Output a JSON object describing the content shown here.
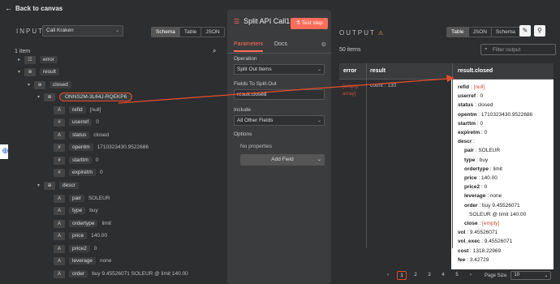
{
  "back_label": "Back to canvas",
  "input": {
    "title": "INPUT",
    "node": "Call Kraken",
    "tabs": [
      "Schema",
      "Table",
      "JSON"
    ],
    "active_tab": "Schema",
    "items": "1 item",
    "tree": [
      {
        "icon": "☷",
        "key": "error",
        "val": "",
        "caret": "▸"
      },
      {
        "icon": "⊕",
        "key": "result",
        "val": "",
        "caret": "▾"
      },
      {
        "icon": "⊕",
        "key": "closed",
        "val": "",
        "caret": "▾"
      },
      {
        "icon": "⊕",
        "key": "ONNS2M-3L64J-RQEKP6",
        "val": "",
        "caret": "▾"
      },
      {
        "icon": "A",
        "key": "refid",
        "val": "[null]"
      },
      {
        "icon": "#",
        "key": "userref",
        "val": "0"
      },
      {
        "icon": "A",
        "key": "status",
        "val": "closed"
      },
      {
        "icon": "#",
        "key": "opentm",
        "val": "1710323430.9522686"
      },
      {
        "icon": "#",
        "key": "starttm",
        "val": "0"
      },
      {
        "icon": "#",
        "key": "expiretm",
        "val": "0"
      },
      {
        "icon": "⊕",
        "key": "descr",
        "val": "",
        "caret": "▾"
      },
      {
        "icon": "A",
        "key": "pair",
        "val": "SOLEUR"
      },
      {
        "icon": "A",
        "key": "type",
        "val": "buy"
      },
      {
        "icon": "A",
        "key": "ordertype",
        "val": "limit"
      },
      {
        "icon": "A",
        "key": "price",
        "val": "140.00"
      },
      {
        "icon": "A",
        "key": "price2",
        "val": "0"
      },
      {
        "icon": "A",
        "key": "leverage",
        "val": "none"
      },
      {
        "icon": "A",
        "key": "order",
        "val": "buy 9.45526071 SOLEUR @ limit 140.00"
      }
    ]
  },
  "node": {
    "title": "Split API Call1",
    "test_button": "Test step",
    "tabs": [
      "Parameters",
      "Docs"
    ],
    "operation_label": "Operation",
    "operation_value": "Split Out Items",
    "fields_label": "Fields To Split Out",
    "fields_value": "result.closed",
    "include_label": "Include",
    "include_value": "All Other Fields",
    "options_label": "Options",
    "no_props": "No properties",
    "add_field": "Add Field"
  },
  "output": {
    "title": "OUTPUT",
    "tabs": [
      "Table",
      "JSON",
      "Schema"
    ],
    "active_tab": "Table",
    "items": "50 items",
    "filter_placeholder": "Filter output",
    "columns": [
      "error",
      "result",
      "result.closed"
    ],
    "error_cell": "[empty array]",
    "result_cell": "count : 130",
    "closed_kv": [
      {
        "k": "refid",
        "v": "[null]",
        "null": true
      },
      {
        "k": "userref",
        "v": "0"
      },
      {
        "k": "status",
        "v": "closed"
      },
      {
        "k": "opentm",
        "v": "1710323430.9522686"
      },
      {
        "k": "starttm",
        "v": "0"
      },
      {
        "k": "expiretm",
        "v": "0"
      },
      {
        "k": "descr",
        "v": ""
      },
      {
        "k": "pair",
        "v": "SOLEUR",
        "indent": true
      },
      {
        "k": "type",
        "v": "buy",
        "indent": true
      },
      {
        "k": "ordertype",
        "v": "limit",
        "indent": true
      },
      {
        "k": "price",
        "v": "140.00",
        "indent": true
      },
      {
        "k": "price2",
        "v": "0",
        "indent": true
      },
      {
        "k": "leverage",
        "v": "none",
        "indent": true
      },
      {
        "k": "order",
        "v": "buy 9.45526071",
        "indent": true
      },
      {
        "k": "",
        "v": "SOLEUR @ limit 140.00",
        "indent2": true
      },
      {
        "k": "close",
        "v": "[empty]",
        "indent": true,
        "null": true
      },
      {
        "k": "vol",
        "v": "9.45526071"
      },
      {
        "k": "vol_exec",
        "v": "9.45526071"
      },
      {
        "k": "cost",
        "v": "1318.22969"
      },
      {
        "k": "fee",
        "v": "3.42729"
      }
    ],
    "pages": [
      "1",
      "2",
      "3",
      "4",
      "5"
    ],
    "active_page": "1",
    "page_size_label": "Page Size",
    "page_size": "10"
  },
  "colors": {
    "accent": "#ff6d5a",
    "highlight": "#e04e2b"
  }
}
